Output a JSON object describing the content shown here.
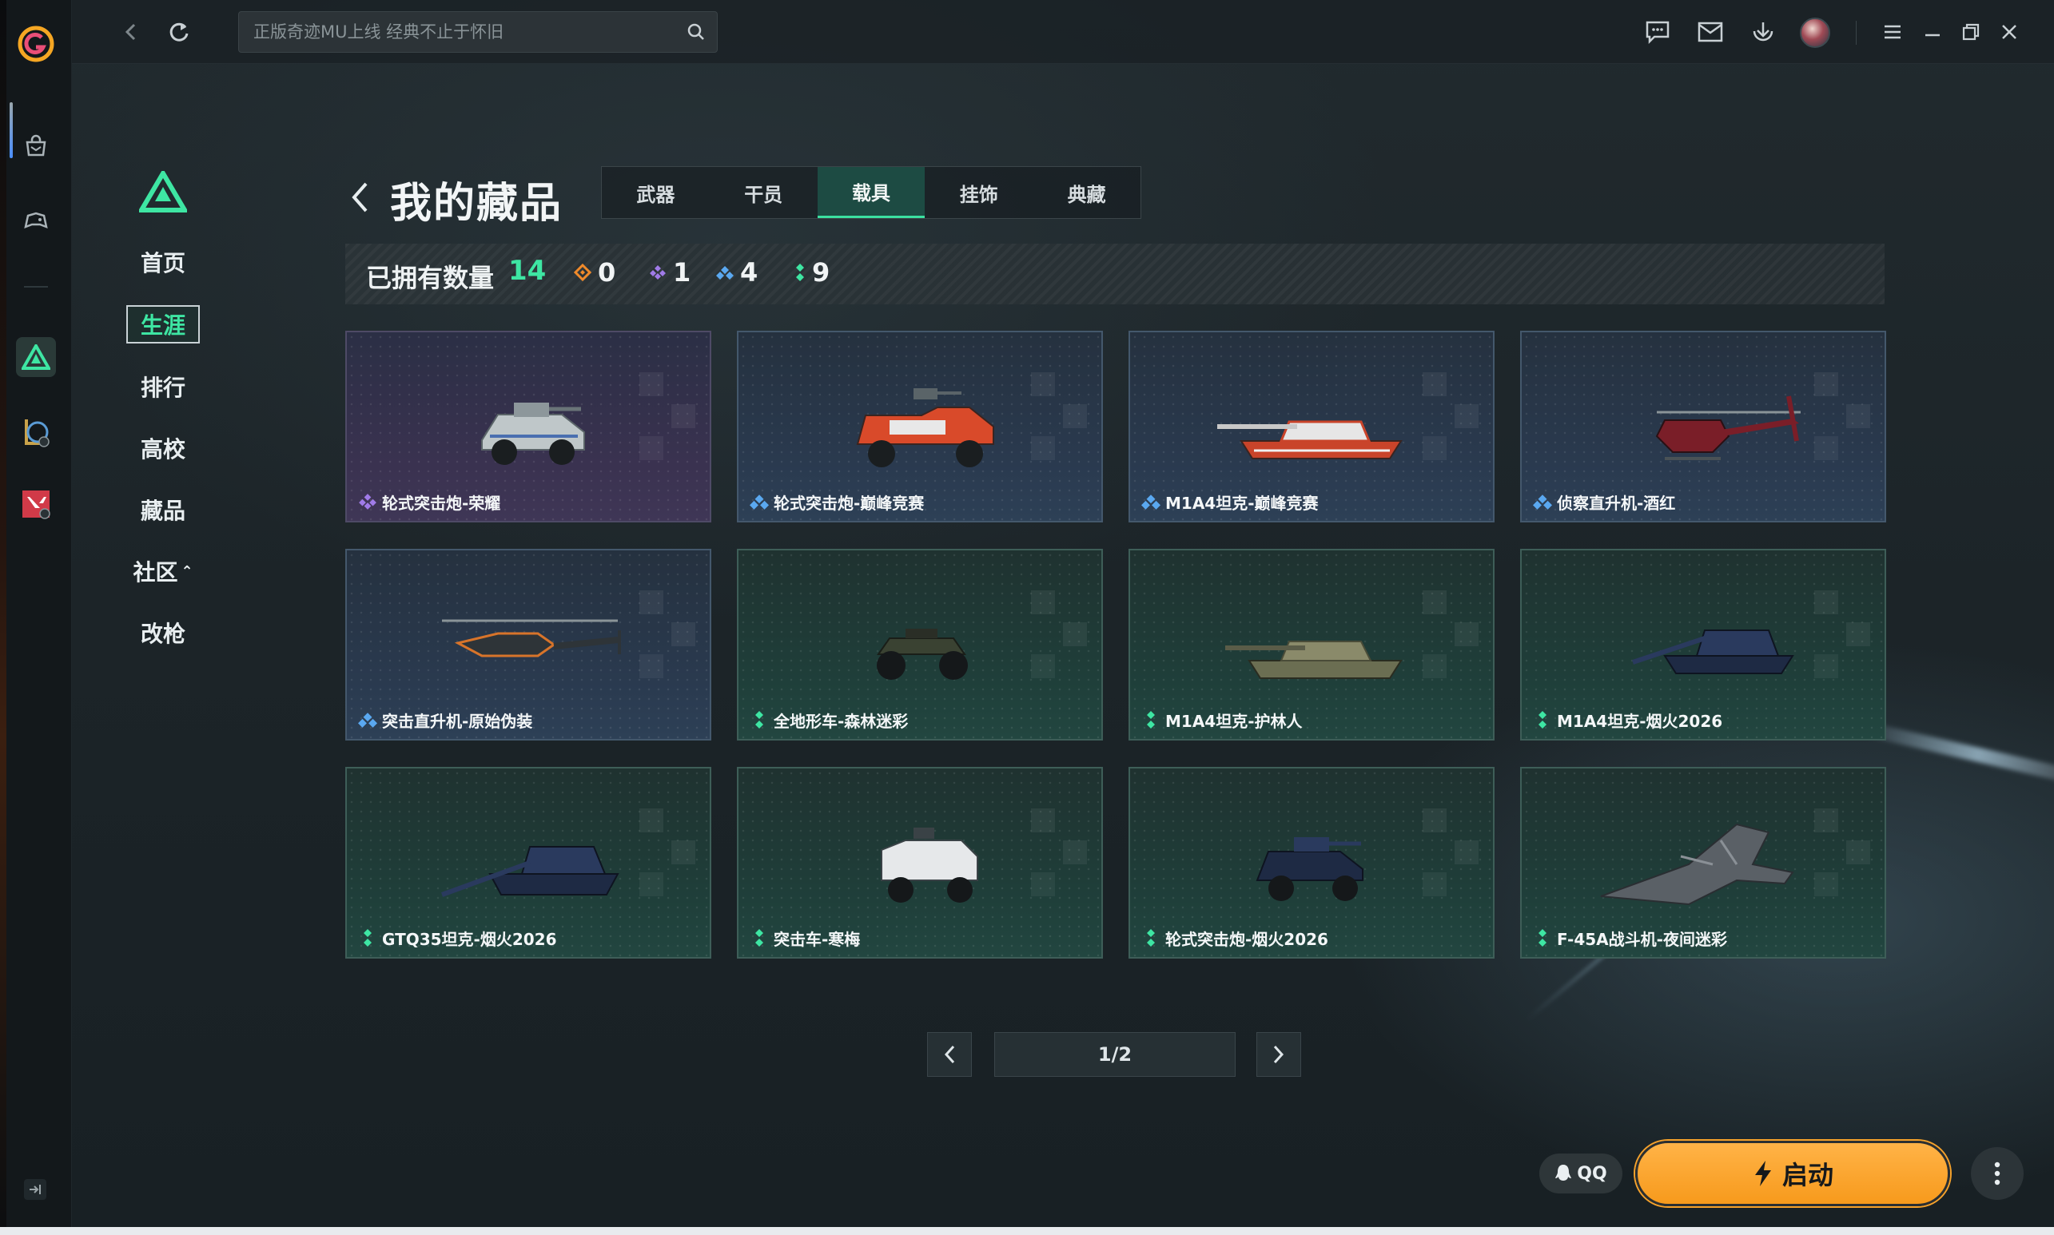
{
  "search": {
    "placeholder": "正版奇迹MU上线 经典不止于怀旧"
  },
  "game_nav": {
    "items": [
      {
        "label": "首页"
      },
      {
        "label": "生涯"
      },
      {
        "label": "排行"
      },
      {
        "label": "高校"
      },
      {
        "label": "藏品"
      },
      {
        "label": "社区"
      },
      {
        "label": "改枪"
      }
    ],
    "active": "生涯"
  },
  "page": {
    "title": "我的藏品",
    "tabs": [
      {
        "label": "武器"
      },
      {
        "label": "干员"
      },
      {
        "label": "载具"
      },
      {
        "label": "挂饰"
      },
      {
        "label": "典藏"
      }
    ],
    "active_tab": "载具"
  },
  "owned": {
    "label": "已拥有数量",
    "total": "14",
    "rarity_counts": [
      {
        "color": "#f08a2a",
        "icon": "orange-rarity-icon",
        "count": "0"
      },
      {
        "color": "#a07be8",
        "icon": "purple-rarity-icon",
        "count": "1"
      },
      {
        "color": "#5aa8f0",
        "icon": "blue-rarity-icon",
        "count": "4"
      },
      {
        "color": "#3ee6a3",
        "icon": "green-rarity-icon",
        "count": "9"
      }
    ]
  },
  "vehicles": [
    {
      "name": "轮式突击炮-荣耀",
      "rarity": "purple",
      "icon": "armored-car-icon"
    },
    {
      "name": "轮式突击炮-巅峰竞赛",
      "rarity": "blue",
      "icon": "armored-car-icon"
    },
    {
      "name": "M1A4坦克-巅峰竞赛",
      "rarity": "blue",
      "icon": "tank-icon"
    },
    {
      "name": "侦察直升机-酒红",
      "rarity": "blue",
      "icon": "helicopter-icon"
    },
    {
      "name": "突击直升机-原始伪装",
      "rarity": "blue",
      "icon": "helicopter-icon"
    },
    {
      "name": "全地形车-森林迷彩",
      "rarity": "green",
      "icon": "atv-icon"
    },
    {
      "name": "M1A4坦克-护林人",
      "rarity": "green",
      "icon": "tank-icon"
    },
    {
      "name": "M1A4坦克-烟火2026",
      "rarity": "green",
      "icon": "tank-icon"
    },
    {
      "name": "GTQ35坦克-烟火2026",
      "rarity": "green",
      "icon": "tank-icon"
    },
    {
      "name": "突击车-寒梅",
      "rarity": "green",
      "icon": "armored-car-icon"
    },
    {
      "name": "轮式突击炮-烟火2026",
      "rarity": "green",
      "icon": "armored-car-icon"
    },
    {
      "name": "F-45A战斗机-夜间迷彩",
      "rarity": "green",
      "icon": "jet-icon"
    }
  ],
  "pagination": {
    "label": "1/2"
  },
  "qq": {
    "label": "QQ"
  },
  "launch": {
    "label": "启动"
  },
  "colors": {
    "accent": "#3ee6a3",
    "launch": "#f79a1c"
  }
}
